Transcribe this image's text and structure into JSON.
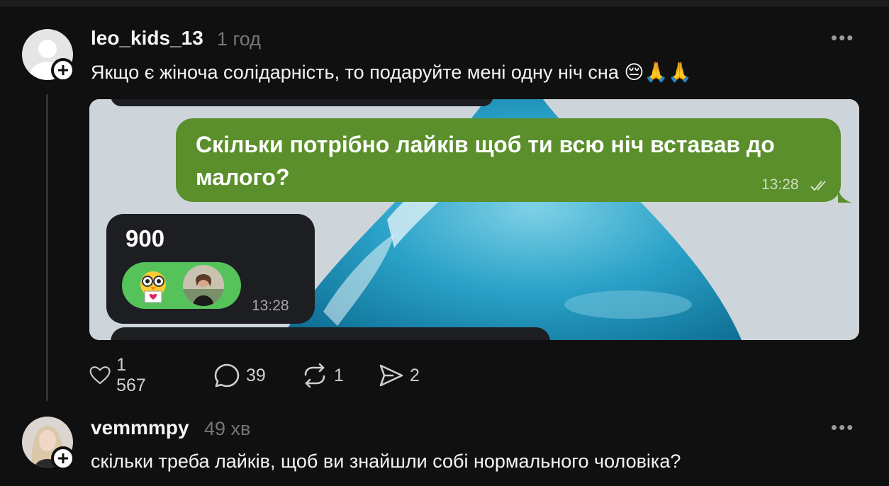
{
  "posts": [
    {
      "username": "leo_kids_13",
      "time": "1 год",
      "text": "Якщо є жіноча солідарність, то подаруйте мені одну ніч сна 😔🙏🙏",
      "media": {
        "outgoing_message": "Скільки потрібно лайків щоб ти всю ніч вставав до малого?",
        "outgoing_time": "13:28",
        "incoming_message": "900",
        "incoming_time": "13:28"
      },
      "actions": {
        "likes": "1 567",
        "replies": "39",
        "reposts": "1",
        "shares": "2"
      }
    },
    {
      "username": "vemmmpy",
      "time": "49 хв",
      "text": "скільки треба лайків, щоб ви знайшли собі нормального чоловіка?"
    }
  ],
  "colors": {
    "background": "#101010",
    "outgoing_bubble": "#5a8f2b",
    "incoming_bubble": "#1c1e21",
    "reaction": "#56c25a"
  }
}
